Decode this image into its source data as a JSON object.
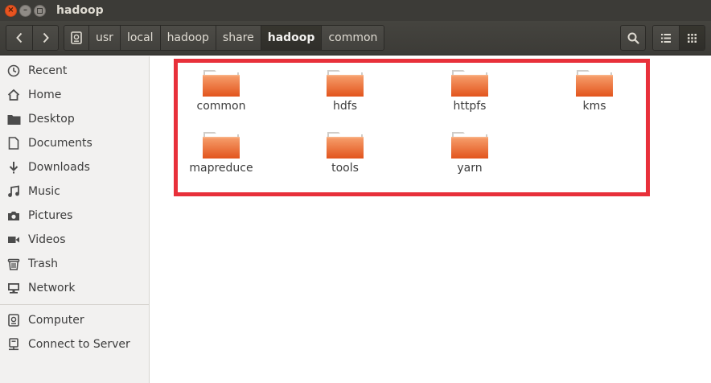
{
  "window": {
    "title": "hadoop"
  },
  "toolbar": {
    "breadcrumbs": [
      "usr",
      "local",
      "hadoop",
      "share",
      "hadoop",
      "common"
    ],
    "active_crumb_index": 4,
    "icons": {
      "back": "chevron-left-icon",
      "forward": "chevron-right-icon",
      "root": "drive-icon",
      "search": "search-icon",
      "list_view": "list-view-icon",
      "grid_view": "grid-view-icon"
    }
  },
  "sidebar": {
    "places": [
      {
        "label": "Recent",
        "icon": "clock-icon"
      },
      {
        "label": "Home",
        "icon": "home-icon"
      },
      {
        "label": "Desktop",
        "icon": "folder-icon"
      },
      {
        "label": "Documents",
        "icon": "document-icon"
      },
      {
        "label": "Downloads",
        "icon": "download-icon"
      },
      {
        "label": "Music",
        "icon": "music-icon"
      },
      {
        "label": "Pictures",
        "icon": "camera-icon"
      },
      {
        "label": "Videos",
        "icon": "video-icon"
      },
      {
        "label": "Trash",
        "icon": "trash-icon"
      },
      {
        "label": "Network",
        "icon": "network-icon"
      }
    ],
    "devices": [
      {
        "label": "Computer",
        "icon": "drive-icon"
      },
      {
        "label": "Connect to Server",
        "icon": "server-icon"
      }
    ]
  },
  "main": {
    "folders": [
      {
        "name": "common"
      },
      {
        "name": "hdfs"
      },
      {
        "name": "httpfs"
      },
      {
        "name": "kms"
      },
      {
        "name": "mapreduce"
      },
      {
        "name": "tools"
      },
      {
        "name": "yarn"
      }
    ],
    "highlight_color": "#e8303a",
    "folder_color": "#e9541f"
  }
}
